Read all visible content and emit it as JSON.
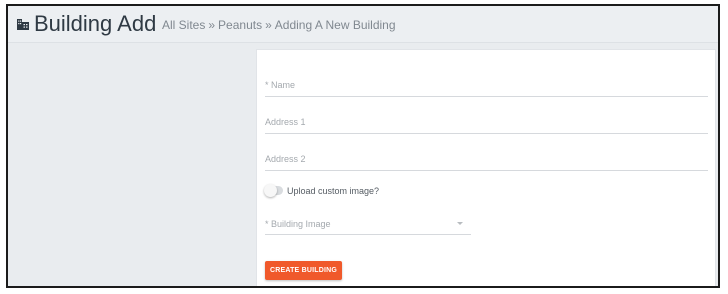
{
  "header": {
    "title": "Building Add",
    "title_icon": "building-icon",
    "breadcrumb": {
      "items": [
        "All Sites",
        "Peanuts",
        "Adding A New Building"
      ],
      "separator": "»"
    }
  },
  "form": {
    "name": {
      "placeholder": "* Name",
      "value": ""
    },
    "address1": {
      "placeholder": "Address 1",
      "value": ""
    },
    "address2": {
      "placeholder": "Address 2",
      "value": ""
    },
    "upload_toggle": {
      "label": "Upload custom image?",
      "checked": false
    },
    "building_image": {
      "placeholder": "* Building Image",
      "icon": "caret-down-icon"
    },
    "submit_label": "CREATE BUILDING"
  },
  "colors": {
    "accent": "#f0592b",
    "background": "#e9ecef",
    "card": "#ffffff",
    "title": "#2f3a44"
  }
}
